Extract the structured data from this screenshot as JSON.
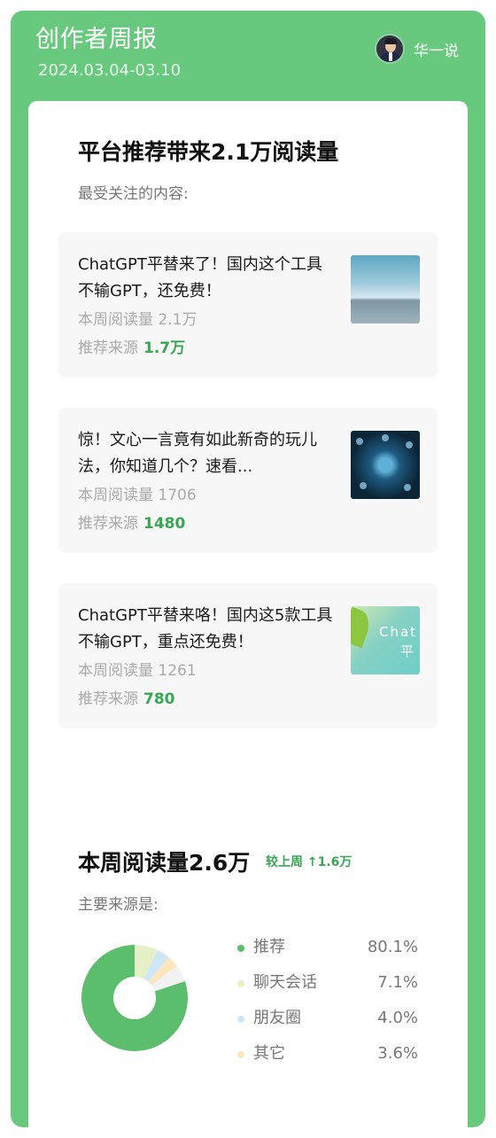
{
  "header": {
    "title": "创作者周报",
    "date_range": "2024.03.04-03.10",
    "user_name": "华一说"
  },
  "recommend": {
    "title": "平台推荐带来2.1万阅读量",
    "subtitle": "最受关注的内容:"
  },
  "articles": [
    {
      "title": "ChatGPT平替来了！国内这个工具不输GPT，还免费！",
      "reads": "本周阅读量 2.1万",
      "source_label": "推荐来源",
      "source_value": "1.7万"
    },
    {
      "title": "惊！文心一言竟有如此新奇的玩儿法，你知道几个？速看...",
      "reads": "本周阅读量 1706",
      "source_label": "推荐来源",
      "source_value": "1480"
    },
    {
      "title": "ChatGPT平替来咯！国内这5款工具不输GPT，重点还免费！",
      "reads": "本周阅读量 1261",
      "source_label": "推荐来源",
      "source_value": "780",
      "thumb_text_1": "Chat",
      "thumb_text_2": "平"
    }
  ],
  "weekly": {
    "title": "本周阅读量2.6万",
    "compare": "较上周 ↑1.6万",
    "subtitle": "主要来源是:"
  },
  "chart_data": {
    "type": "pie",
    "categories": [
      "推荐",
      "聊天会话",
      "朋友圈",
      "其它"
    ],
    "values": [
      80.1,
      7.1,
      4.0,
      3.6
    ],
    "labels": [
      "80.1%",
      "7.1%",
      "4.0%",
      "3.6%"
    ],
    "colors": [
      "#5cbd6c",
      "#e5f0c8",
      "#cfe6f7",
      "#fbe6bf"
    ],
    "remainder_color": "#f2f2f2"
  }
}
